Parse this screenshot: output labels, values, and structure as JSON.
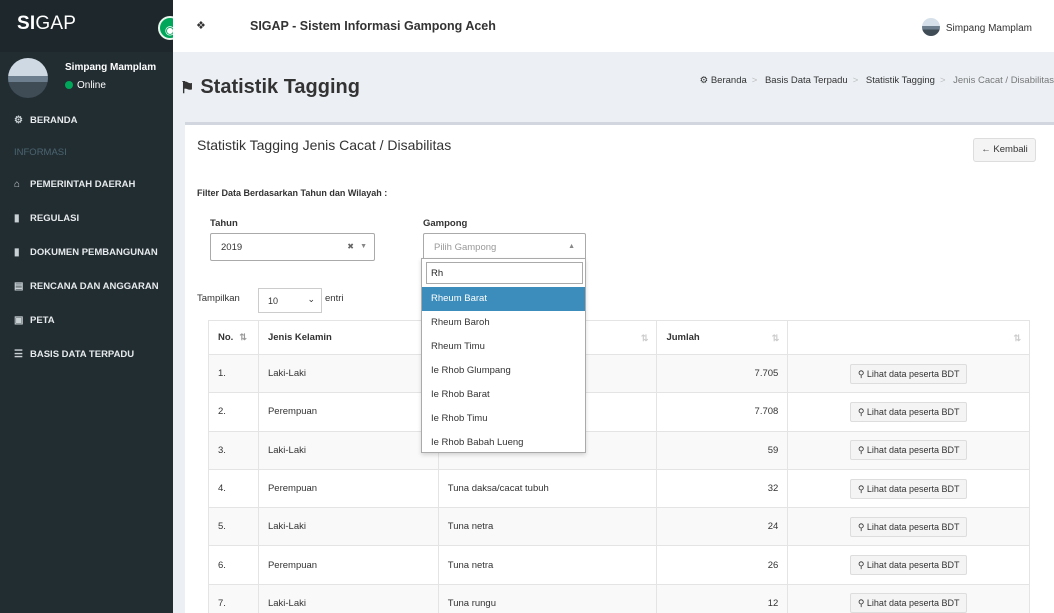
{
  "sidebar": {
    "logo_bold": "SI",
    "logo_rest": "GAP",
    "toggle_icon": "arrow-circle-icon",
    "user_name": "Simpang Mamplam",
    "user_status": "Online",
    "menu": [
      {
        "label": "BERANDA",
        "icon": "dashboard-icon"
      },
      {
        "label": "INFORMASI",
        "header": true
      },
      {
        "label": "PEMERINTAH DAERAH",
        "icon": "institution-icon"
      },
      {
        "label": "REGULASI",
        "icon": "book-icon"
      },
      {
        "label": "DOKUMEN PEMBANGUNAN",
        "icon": "book-icon"
      },
      {
        "label": "RENCANA DAN ANGGARAN",
        "icon": "file-icon"
      },
      {
        "label": "PETA",
        "icon": "map-icon"
      },
      {
        "label": "BASIS DATA TERPADU",
        "icon": "database-icon"
      }
    ]
  },
  "topbar": {
    "title": "SIGAP - Sistem Informasi Gampong Aceh",
    "user": "Simpang Mamplam"
  },
  "header": {
    "title": "Statistik Tagging",
    "breadcrumb": [
      "Beranda",
      "Basis Data Terpadu",
      "Statistik Tagging",
      "Jenis Cacat / Disabilitas"
    ]
  },
  "box": {
    "title": "Statistik Tagging Jenis Cacat / Disabilitas",
    "back_label": "Kembali",
    "filter_title": "Filter Data Berdasarkan Tahun dan Wilayah :",
    "tahun_label": "Tahun",
    "tahun_value": "2019",
    "gampong_label": "Gampong",
    "gampong_placeholder": "Pilih Gampong",
    "show_label": "Tampilkan",
    "page_length": "10",
    "entries_label": "entri"
  },
  "table": {
    "headers": [
      "No.",
      "Jenis Kelamin",
      "",
      "Jumlah",
      ""
    ],
    "rows": [
      {
        "no": "1.",
        "gender": "Laki-Laki",
        "type": "",
        "count": "7.705",
        "action": "Lihat data peserta BDT"
      },
      {
        "no": "2.",
        "gender": "Perempuan",
        "type": "",
        "count": "7.708",
        "action": "Lihat data peserta BDT"
      },
      {
        "no": "3.",
        "gender": "Laki-Laki",
        "type": "",
        "count": "59",
        "action": "Lihat data peserta BDT"
      },
      {
        "no": "4.",
        "gender": "Perempuan",
        "type": "Tuna daksa/cacat tubuh",
        "count": "32",
        "action": "Lihat data peserta BDT"
      },
      {
        "no": "5.",
        "gender": "Laki-Laki",
        "type": "Tuna netra",
        "count": "24",
        "action": "Lihat data peserta BDT"
      },
      {
        "no": "6.",
        "gender": "Perempuan",
        "type": "Tuna netra",
        "count": "26",
        "action": "Lihat data peserta BDT"
      },
      {
        "no": "7.",
        "gender": "Laki-Laki",
        "type": "Tuna rungu",
        "count": "12",
        "action": "Lihat data peserta BDT"
      }
    ]
  },
  "dropdown": {
    "search_value": "Rh",
    "options": [
      "Rheum Barat",
      "Rheum Baroh",
      "Rheum Timu",
      "Ie Rhob Glumpang",
      "Ie Rhob Barat",
      "Ie Rhob Timu",
      "Ie Rhob Babah Lueng"
    ],
    "highlighted": 0
  },
  "colors": {
    "sidebar_bg": "#222d32",
    "accent_green": "#00a65a",
    "highlight_blue": "#3c8dbc"
  }
}
